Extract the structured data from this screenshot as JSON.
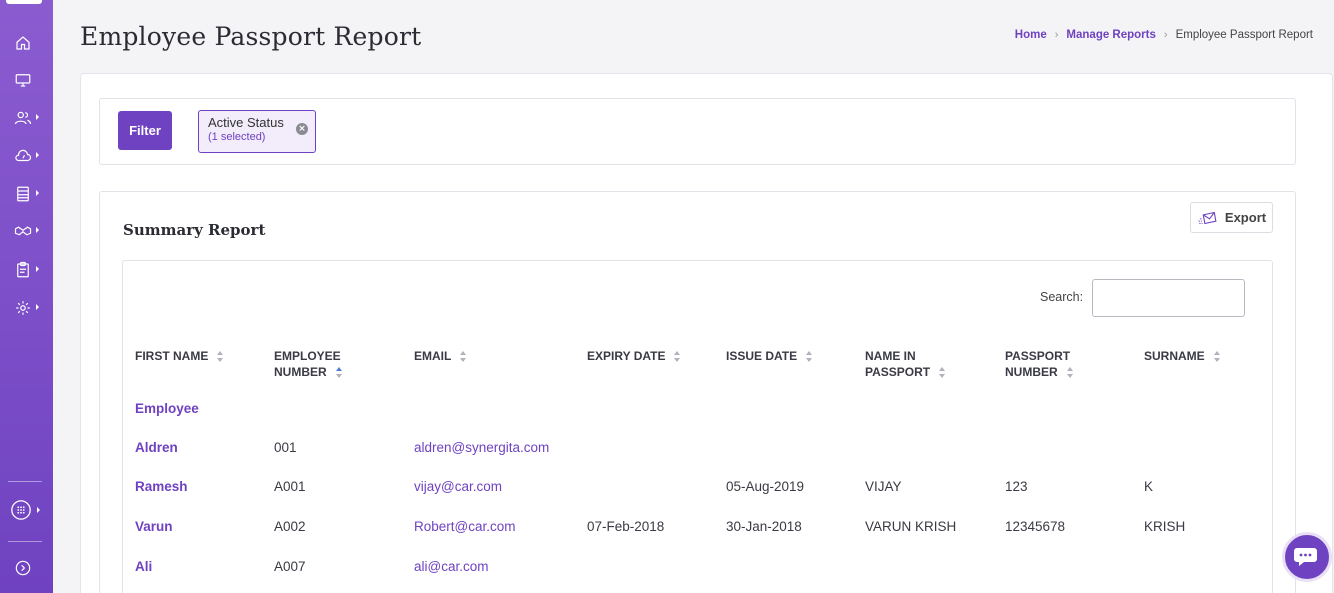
{
  "app": {
    "accent": "#6f42c1"
  },
  "sidebar": {
    "items": [
      {
        "icon": "home-icon"
      },
      {
        "icon": "monitor-icon"
      },
      {
        "icon": "users-icon"
      },
      {
        "icon": "cloud-icon"
      },
      {
        "icon": "database-icon"
      },
      {
        "icon": "handshake-icon"
      },
      {
        "icon": "clipboard-icon"
      },
      {
        "icon": "gear-icon"
      },
      {
        "icon": "apps-grid-icon"
      },
      {
        "icon": "expand-icon"
      }
    ]
  },
  "header": {
    "title": "Employee Passport Report",
    "breadcrumb": {
      "home": "Home",
      "section": "Manage Reports",
      "current": "Employee Passport Report"
    }
  },
  "filter": {
    "button_label": "Filter",
    "chip": {
      "label": "Active Status",
      "sub": "(1 selected)",
      "close": "×"
    }
  },
  "summary": {
    "title": "Summary Report",
    "export_label": "Export",
    "search_label": "Search:",
    "search_value": "",
    "columns": [
      {
        "line1": "FIRST NAME",
        "line2": ""
      },
      {
        "line1": "EMPLOYEE",
        "line2": "NUMBER"
      },
      {
        "line1": "EMAIL",
        "line2": ""
      },
      {
        "line1": "EXPIRY DATE",
        "line2": ""
      },
      {
        "line1": "ISSUE DATE",
        "line2": ""
      },
      {
        "line1": "NAME IN",
        "line2": "PASSPORT"
      },
      {
        "line1": "PASSPORT",
        "line2": "NUMBER"
      },
      {
        "line1": "SURNAME",
        "line2": ""
      }
    ],
    "rows": [
      {
        "first_name": "Employee",
        "emp_no": "",
        "email": "",
        "expiry": "",
        "issue": "",
        "name_in_passport": "",
        "passport_no": "",
        "surname": ""
      },
      {
        "first_name": "Aldren",
        "emp_no": "001",
        "email": "aldren@synergita.com",
        "expiry": "",
        "issue": "",
        "name_in_passport": "",
        "passport_no": "",
        "surname": ""
      },
      {
        "first_name": "Ramesh",
        "emp_no": "A001",
        "email": "vijay@car.com",
        "expiry": "",
        "issue": "05-Aug-2019",
        "name_in_passport": "VIJAY",
        "passport_no": "123",
        "surname": "K"
      },
      {
        "first_name": "Varun",
        "emp_no": "A002",
        "email": "Robert@car.com",
        "expiry": "07-Feb-2018",
        "issue": "30-Jan-2018",
        "name_in_passport": "VARUN KRISH",
        "passport_no": "12345678",
        "surname": "KRISH"
      },
      {
        "first_name": "Ali",
        "emp_no": "A007",
        "email": "ali@car.com",
        "expiry": "",
        "issue": "",
        "name_in_passport": "",
        "passport_no": "",
        "surname": ""
      }
    ]
  },
  "chat": {
    "icon": "chat-bubble-icon"
  }
}
